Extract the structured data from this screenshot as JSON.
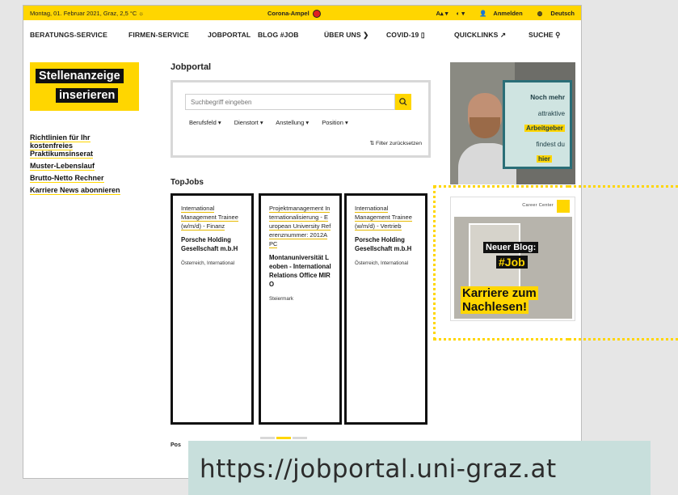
{
  "topbar": {
    "date_weather": "Montag, 01. Februar 2021, Graz, 2,5 °C ☼",
    "corona_label": "Corona-Ampel",
    "font_size": "A▴ ▾",
    "contrast": "◐ ▾",
    "login": "Anmelden",
    "language": "Deutsch"
  },
  "nav": {
    "items": [
      "BERATUNGS-SERVICE",
      "FIRMEN-SERVICE",
      "JOBPORTAL",
      "BLOG #JOB",
      "ÜBER UNS ❯",
      "COVID-19 ▯",
      "QUICKLINKS ↗",
      "SUCHE ⚲"
    ]
  },
  "sidebar": {
    "cta_line1": "Stellenanzeige",
    "cta_line2": "inserieren",
    "links": [
      "Richtlinien für Ihr kostenfreies Praktikumsinserat",
      "Muster-Lebenslauf",
      "Brutto-Netto Rechner",
      "Karriere News abonnieren"
    ]
  },
  "jobportal": {
    "heading": "Jobportal",
    "search_placeholder": "Suchbegriff eingeben",
    "filters": [
      "Berufsfeld ▾",
      "Dienstort ▾",
      "Anstellung ▾",
      "Position ▾"
    ],
    "reset": "⇅ Filter zurücksetzen"
  },
  "topjobs": {
    "heading": "TopJobs",
    "cards": [
      {
        "title": "International Management Trainee (w/m/d) - Finanz",
        "company": "Porsche Holding Gesellschaft m.b.H",
        "location": "Österreich, International"
      },
      {
        "title": "Projektmanagement Internationalisierung - European University Referenznummer: 2012APC",
        "company": "Montanuniversität Leoben - International Relations Office MIRO",
        "location": "Steiermark"
      },
      {
        "title": "International Management Trainee (w/m/d) - Vertrieb",
        "company": "Porsche Holding Gesellschaft m.b.H",
        "location": "Österreich, International"
      }
    ]
  },
  "bottom_label": "Pos",
  "ad_arbeitgeber": {
    "lines": [
      "Noch mehr",
      "attraktive",
      "Arbeitgeber",
      "findest du",
      "hier"
    ]
  },
  "ad_blog": {
    "brand": "Career Center",
    "blog": "Neuer Blog:",
    "tag": "#Job",
    "line1": "Karriere zum",
    "line2": "Nachlesen!"
  },
  "url": "https://jobportal.uni-graz.at",
  "colors": {
    "accent": "#ffd600",
    "text": "#111111",
    "url_bg": "#c8dfdc"
  }
}
